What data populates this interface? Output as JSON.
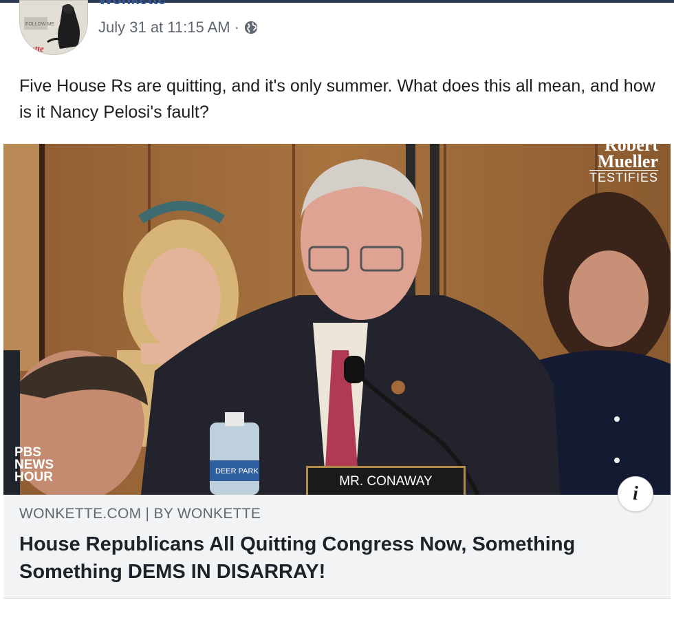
{
  "post": {
    "page_name": "Wonkette",
    "timestamp": "July 31 at 11:15 AM",
    "separator": "·",
    "privacy_icon": "globe-icon",
    "text": "Five House Rs are quitting, and it's only summer. What does this all mean, and how is it Nancy Pelosi's fault?"
  },
  "avatar": {
    "badge_text": "FOLLOW ME",
    "logo_text": "ette"
  },
  "media": {
    "network_logo": [
      "PBS",
      "NEWS",
      "HOUR"
    ],
    "corner_title": [
      "Robert",
      "Mueller"
    ],
    "corner_subtitle": "TESTIFIES",
    "nameplate": "MR. CONAWAY",
    "bottle_label": "DEER PARK"
  },
  "link": {
    "domain": "WONKETTE.COM | BY WONKETTE",
    "title": "House Republicans All Quitting Congress Now, Something Something DEMS IN DISARRAY!",
    "info_icon": "info-icon",
    "info_label": "i"
  },
  "colors": {
    "accent": "#385898",
    "text": "#1c1e21",
    "meta": "#616770",
    "link_bg": "#f2f3f5"
  }
}
